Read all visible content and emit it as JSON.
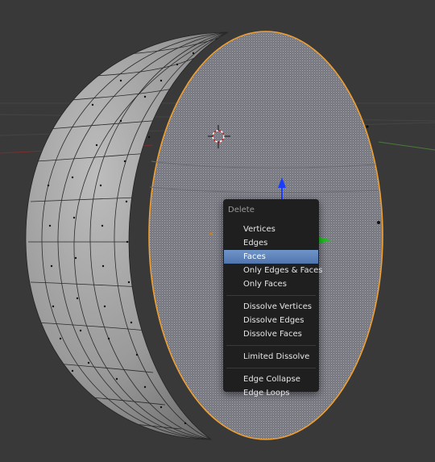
{
  "viewport": {
    "object": "sphere-half"
  },
  "delete_menu": {
    "title": "Delete",
    "groups": [
      [
        {
          "label": "Vertices",
          "name": "menu-item-vertices",
          "active": false
        },
        {
          "label": "Edges",
          "name": "menu-item-edges",
          "active": false
        },
        {
          "label": "Faces",
          "name": "menu-item-faces",
          "active": true
        },
        {
          "label": "Only Edges & Faces",
          "name": "menu-item-only-edges-faces",
          "active": false
        },
        {
          "label": "Only Faces",
          "name": "menu-item-only-faces",
          "active": false
        }
      ],
      [
        {
          "label": "Dissolve Vertices",
          "name": "menu-item-dissolve-vertices",
          "active": false
        },
        {
          "label": "Dissolve Edges",
          "name": "menu-item-dissolve-edges",
          "active": false
        },
        {
          "label": "Dissolve Faces",
          "name": "menu-item-dissolve-faces",
          "active": false
        }
      ],
      [
        {
          "label": "Limited Dissolve",
          "name": "menu-item-limited-dissolve",
          "active": false
        }
      ],
      [
        {
          "label": "Edge Collapse",
          "name": "menu-item-edge-collapse",
          "active": false
        },
        {
          "label": "Edge Loops",
          "name": "menu-item-edge-loops",
          "active": false
        }
      ]
    ]
  },
  "colors": {
    "background": "#393939",
    "selection_outline": "#f0a030",
    "face_fill": "#7d7d84",
    "mesh_shaded": "#9a9a9a",
    "highlight": "#5b84bf",
    "gizmo_z": "#1a3cff",
    "gizmo_y": "#22c022"
  }
}
